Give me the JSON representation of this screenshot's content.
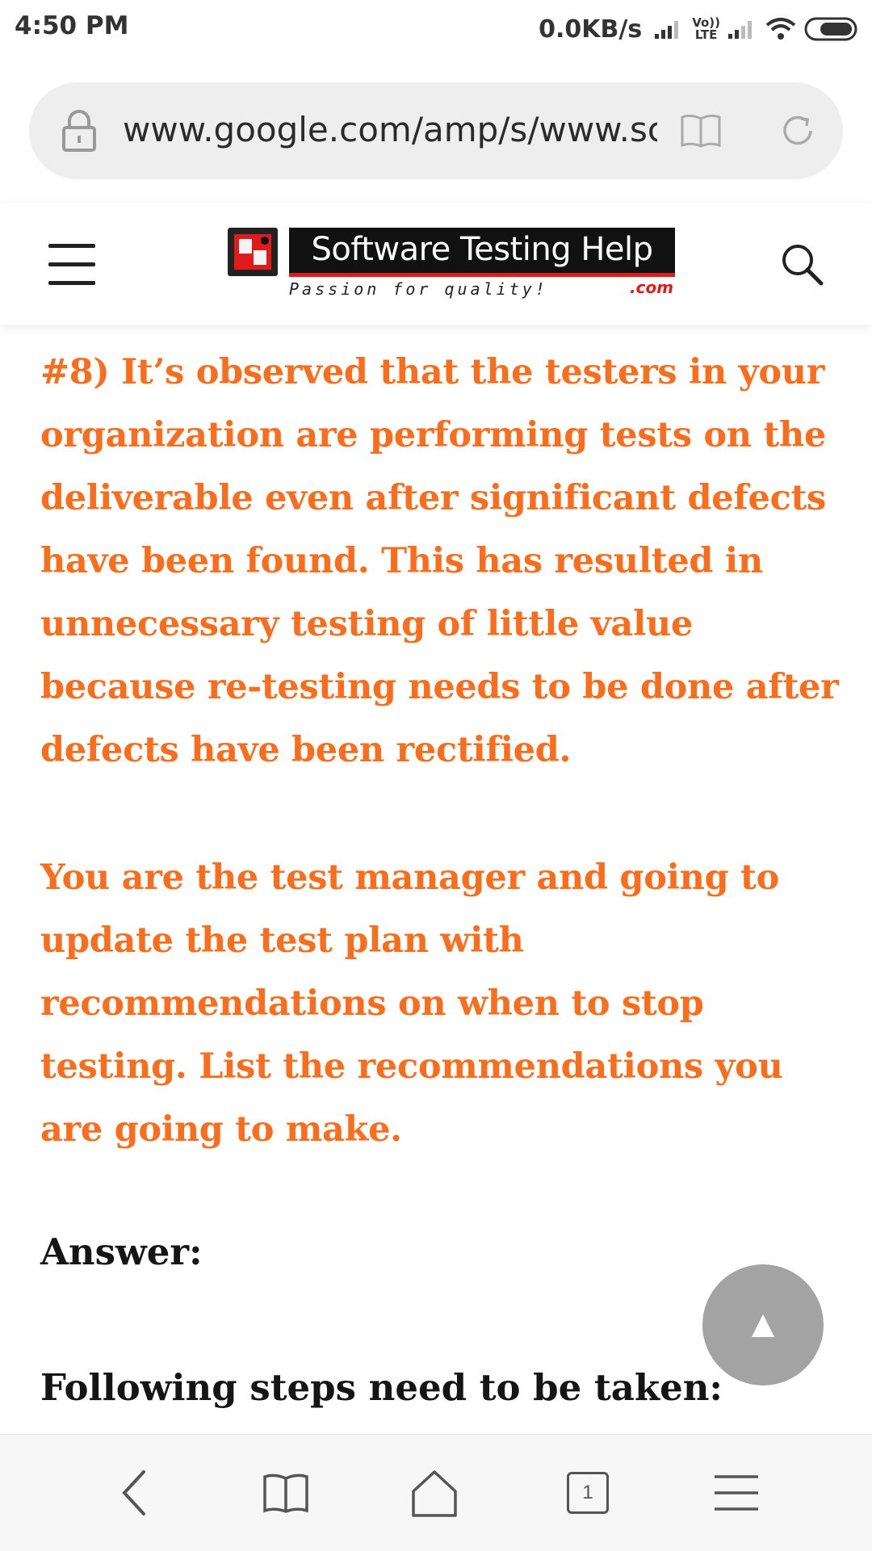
{
  "status_bar": {
    "time": "4:50 PM",
    "net_speed": "0.0KB/s",
    "lte_top": "Vo))",
    "lte_bottom": "LTE"
  },
  "address_bar": {
    "url": "www.google.com/amp/s/www.sc"
  },
  "site_header": {
    "logo_title": "Software Testing Help",
    "logo_tagline": "Passion for quality!",
    "logo_domain": ".com"
  },
  "article": {
    "question_p1": "#8) It’s observed that the testers in your organization are performing tests on the deliverable even after significant defects have been found. This has resulted in unnecessary testing of little value because re-testing needs to be done after defects have been rectified.",
    "question_p2": "You are the test manager and going to update the test plan with recommendations on when to stop testing. List the recommendations you are going to make.",
    "answer_label": "Answer:",
    "steps_label": "Following steps need to be taken:"
  },
  "scroll_top": {
    "glyph": "▲"
  },
  "bottom_nav": {
    "tab_count": "1"
  },
  "colors": {
    "question_text": "#f96d1c",
    "logo_red": "#e01b1b",
    "fab": "#a3a3a3"
  }
}
